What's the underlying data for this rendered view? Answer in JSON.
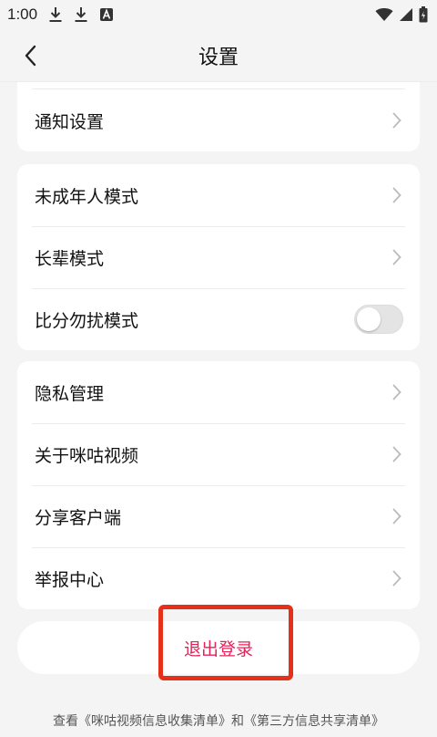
{
  "status_bar": {
    "time": "1:00"
  },
  "header": {
    "title": "设置",
    "back_icon": "chevron-left-icon"
  },
  "groups": [
    {
      "items": [
        {
          "label": "通知设置",
          "control": "chevron"
        }
      ]
    },
    {
      "items": [
        {
          "label": "未成年人模式",
          "control": "chevron"
        },
        {
          "label": "长辈模式",
          "control": "chevron"
        },
        {
          "label": "比分勿扰模式",
          "control": "toggle",
          "on": false
        }
      ]
    },
    {
      "items": [
        {
          "label": "隐私管理",
          "control": "chevron"
        },
        {
          "label": "关于咪咕视频",
          "control": "chevron"
        },
        {
          "label": "分享客户端",
          "control": "chevron"
        },
        {
          "label": "举报中心",
          "control": "chevron"
        }
      ]
    }
  ],
  "logout": {
    "label": "退出登录",
    "color": "#e2245a"
  },
  "highlight": {
    "color": "#e5311a"
  },
  "footer": {
    "note": "查看《咪咕视频信息收集清单》和《第三方信息共享清单》"
  }
}
